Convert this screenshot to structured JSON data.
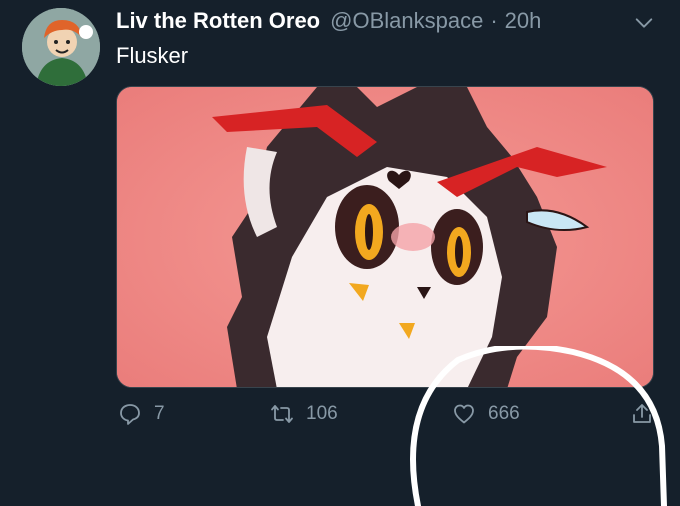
{
  "tweet": {
    "display_name": "Liv the Rotten Oreo",
    "handle": "@OBlankspace",
    "separator": "·",
    "timestamp": "20h",
    "text": "Flusker"
  },
  "actions": {
    "reply_count": "7",
    "retweet_count": "106",
    "like_count": "666"
  },
  "icons": {
    "menu": "chevron-down-icon",
    "reply": "reply-icon",
    "retweet": "retweet-icon",
    "like": "heart-icon",
    "share": "share-icon"
  },
  "colors": {
    "background": "#15202b",
    "secondary_text": "#8899a6",
    "media_background": "#ef8482",
    "annotation_circle": "#ffffff"
  }
}
